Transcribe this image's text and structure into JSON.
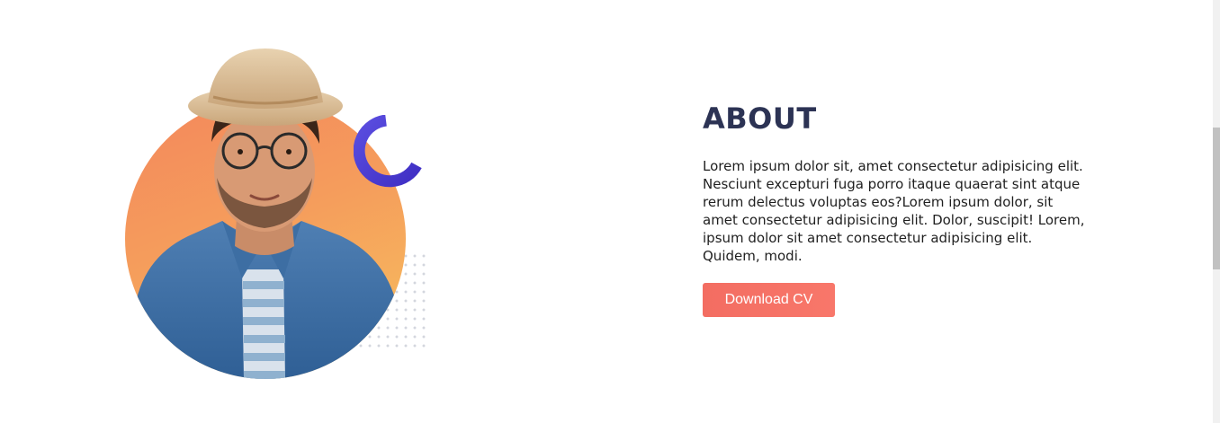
{
  "about": {
    "title": "ABOUT",
    "description": "Lorem ipsum dolor sit, amet consectetur adipisicing elit. Nesciunt excepturi fuga porro itaque quaerat sint atque rerum delectus voluptas eos?Lorem ipsum dolor, sit amet consectetur adipisicing elit. Dolor, suscipit! Lorem, ipsum dolor sit amet consectetur adipisicing elit. Quidem, modi.",
    "button_label": "Download CV"
  },
  "icons": {
    "profile": "profile-photo",
    "arc": "arc-decoration-icon",
    "dots": "dot-pattern"
  },
  "colors": {
    "title": "#2c3354",
    "button": "#f36d62",
    "circle_top": "#f4875c",
    "circle_bottom": "#f7c25e",
    "arc": "#4b3bd1"
  }
}
